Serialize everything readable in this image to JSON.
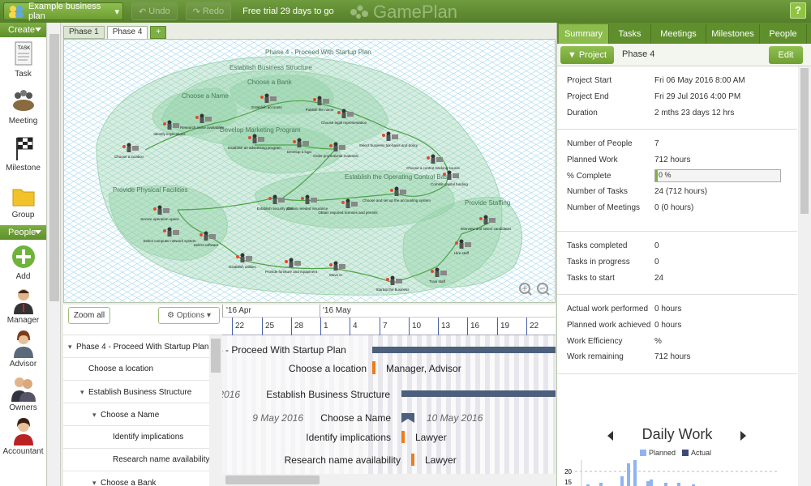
{
  "header": {
    "plan_name": "Example business plan",
    "undo": "Undo",
    "redo": "Redo",
    "trial": "Free trial 29 days to go",
    "logo": "GamePlan",
    "help": "?"
  },
  "left": {
    "create_label": "Create",
    "create_items": [
      {
        "label": "Task",
        "icon": "task-icon"
      },
      {
        "label": "Meeting",
        "icon": "meeting-icon"
      },
      {
        "label": "Milestone",
        "icon": "milestone-flag-icon"
      },
      {
        "label": "Group",
        "icon": "group-folder-icon"
      }
    ],
    "people_label": "People",
    "people_items": [
      {
        "label": "Add",
        "icon": "add-person-icon"
      },
      {
        "label": "Manager",
        "icon": "manager-icon"
      },
      {
        "label": "Advisor",
        "icon": "advisor-icon"
      },
      {
        "label": "Owners",
        "icon": "owners-icon"
      },
      {
        "label": "Accountant",
        "icon": "accountant-icon"
      }
    ]
  },
  "tabs": [
    {
      "label": "Phase 1"
    },
    {
      "label": "Phase 4"
    },
    {
      "label": "+"
    }
  ],
  "map": {
    "title": "Phase 4 - Proceed With Startup Plan",
    "groups": [
      "Establish Business Structure",
      "Choose a Bank",
      "Choose a Name",
      "Develop Marketing Program",
      "Establish the Operating Control Base",
      "Provide Physical Facilities",
      "Provide Staffing"
    ],
    "tasks": [
      "Establish accounts",
      "Research name availability",
      "Identify implications",
      "Choose a location",
      "Establish an advertising program",
      "Develop a logo",
      "Order promotional materials",
      "Select business tax-basis and policy",
      "Choose a control tracking source",
      "Commit capital funding",
      "Choose and set up the accounting system",
      "Obtain required licenses and permits",
      "Obtain needed insurance",
      "Establish security plan",
      "Secure operation space",
      "Select computer network system",
      "Select software",
      "Establish utilities",
      "Provide furniture and equipment",
      "Move in",
      "Startup the business",
      "Interview and select candidates",
      "Hire staff",
      "Train staff",
      "Publish the name",
      "Choose legal representation"
    ]
  },
  "gantt": {
    "zoom_all": "Zoom all",
    "options": "Options",
    "months": [
      "'16  Apr",
      "'16  May"
    ],
    "days": [
      "22",
      "25",
      "28",
      "1",
      "4",
      "7",
      "10",
      "13",
      "16",
      "19",
      "22"
    ],
    "tree": [
      {
        "label": "Phase 4 - Proceed With Startup Plan",
        "indent": 0,
        "toggle": "▾"
      },
      {
        "label": "Choose a location",
        "indent": 1,
        "toggle": ""
      },
      {
        "label": "Establish Business Structure",
        "indent": 1,
        "toggle": "▾"
      },
      {
        "label": "Choose a Name",
        "indent": 2,
        "toggle": "▾"
      },
      {
        "label": "Identify implications",
        "indent": 3,
        "toggle": ""
      },
      {
        "label": "Research name availability",
        "indent": 3,
        "toggle": ""
      },
      {
        "label": "Choose a Bank",
        "indent": 2,
        "toggle": "▾"
      }
    ],
    "bar_labels": {
      "phase": "e 4 - Proceed With Startup Plan",
      "location": "Choose a location",
      "location_res": "Manager, Advisor",
      "ebs_date": "y 2016",
      "ebs": "Establish Business Structure",
      "name_start": "9 May 2016",
      "name": "Choose a Name",
      "name_end": "10 May 2016",
      "identify": "Identify implications",
      "identify_res": "Lawyer",
      "research": "Research name availability",
      "research_res": "Lawyer"
    }
  },
  "right": {
    "tabs": [
      "Summary",
      "Tasks",
      "Meetings",
      "Milestones",
      "People"
    ],
    "project_btn": "Project",
    "phase": "Phase 4",
    "edit": "Edit",
    "sections": [
      [
        {
          "k": "Project Start",
          "v": "Fri 06 May 2016 8:00 AM"
        },
        {
          "k": "Project End",
          "v": "Fri 29 Jul 2016 4:00 PM"
        },
        {
          "k": "Duration",
          "v": "2 mths 23 days 12 hrs"
        }
      ],
      [
        {
          "k": "Number of People",
          "v": "7"
        },
        {
          "k": "Planned Work",
          "v": "712 hours"
        },
        {
          "k": "% Complete",
          "v": "0 %"
        },
        {
          "k": "Number of Tasks",
          "v": "24  (712 hours)"
        },
        {
          "k": "Number of Meetings",
          "v": "0   (0 hours)"
        }
      ],
      [
        {
          "k": "Tasks completed",
          "v": "0"
        },
        {
          "k": "Tasks in progress",
          "v": "0"
        },
        {
          "k": "Tasks to start",
          "v": "24"
        }
      ],
      [
        {
          "k": "Actual work performed",
          "v": "0 hours"
        },
        {
          "k": "Planned work achieved",
          "v": "0 hours"
        },
        {
          "k": "Work Efficiency",
          "v": "%"
        },
        {
          "k": "Work remaining",
          "v": "712 hours"
        }
      ]
    ],
    "percent_complete": 0,
    "daily": {
      "title": "Daily Work",
      "legend": [
        "Planned",
        "Actual"
      ],
      "colors": {
        "planned": "#8fb4f0",
        "actual": "#3b4a7a"
      },
      "ticks": [
        "20",
        "15"
      ],
      "bars": [
        0,
        0,
        0,
        0,
        0,
        0,
        0,
        0,
        0,
        0,
        0,
        0,
        0,
        0,
        0,
        0,
        0,
        0,
        0,
        0,
        0,
        0,
        0,
        0,
        0,
        0,
        0,
        0,
        0
      ]
    }
  }
}
